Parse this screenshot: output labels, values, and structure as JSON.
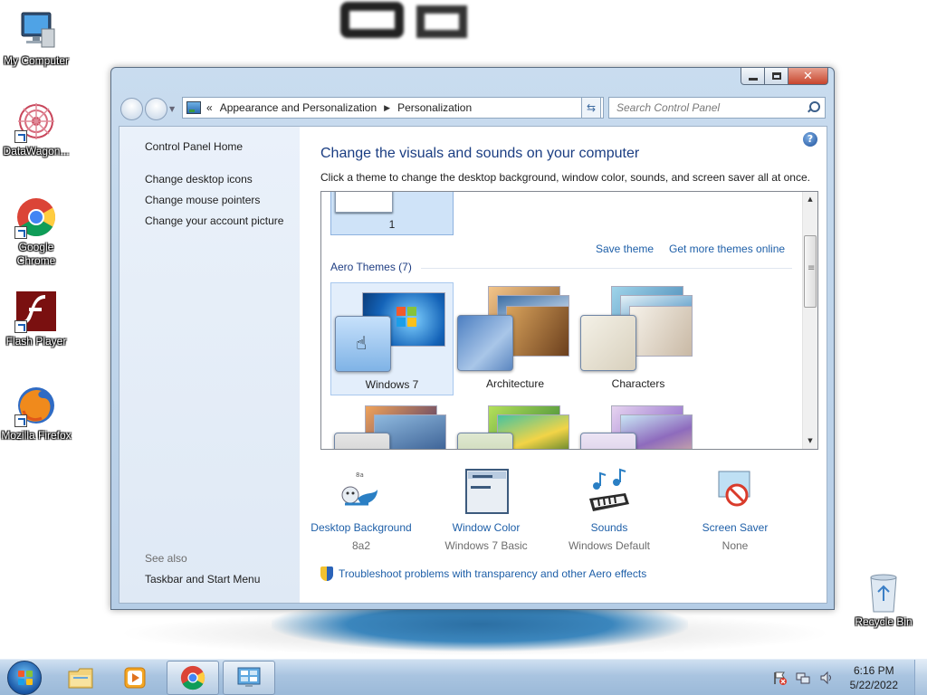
{
  "desktop": {
    "icons": [
      {
        "label": "My Computer"
      },
      {
        "label": "DataWagon..."
      },
      {
        "label": "Google Chrome"
      },
      {
        "label": "Flash Player"
      },
      {
        "label": "Mozilla Firefox"
      },
      {
        "label": "Recycle Bin"
      }
    ]
  },
  "window": {
    "breadcrumb": {
      "chevrons": "«",
      "items": [
        "Appearance and Personalization",
        "Personalization"
      ]
    },
    "search_placeholder": "Search Control Panel",
    "sidebar": {
      "home": "Control Panel Home",
      "links": [
        "Change desktop icons",
        "Change mouse pointers",
        "Change your account picture"
      ],
      "see_also_heading": "See also",
      "see_also_links": [
        "Taskbar and Start Menu"
      ]
    },
    "main": {
      "title": "Change the visuals and sounds on your computer",
      "subtitle": "Click a theme to change the desktop background, window color, sounds, and screen saver all at once.",
      "my_theme_label": "1",
      "save_theme": "Save theme",
      "get_more_themes": "Get more themes online",
      "group_heading": "Aero Themes (7)",
      "themes": [
        "Windows 7",
        "Architecture",
        "Characters"
      ],
      "settings": [
        {
          "name": "Desktop Background",
          "value": "8a2"
        },
        {
          "name": "Window Color",
          "value": "Windows 7 Basic"
        },
        {
          "name": "Sounds",
          "value": "Windows Default"
        },
        {
          "name": "Screen Saver",
          "value": "None"
        }
      ],
      "troubleshoot": "Troubleshoot problems with transparency and other Aero effects"
    }
  },
  "taskbar": {
    "time": "6:16 PM",
    "date": "5/22/2022"
  }
}
